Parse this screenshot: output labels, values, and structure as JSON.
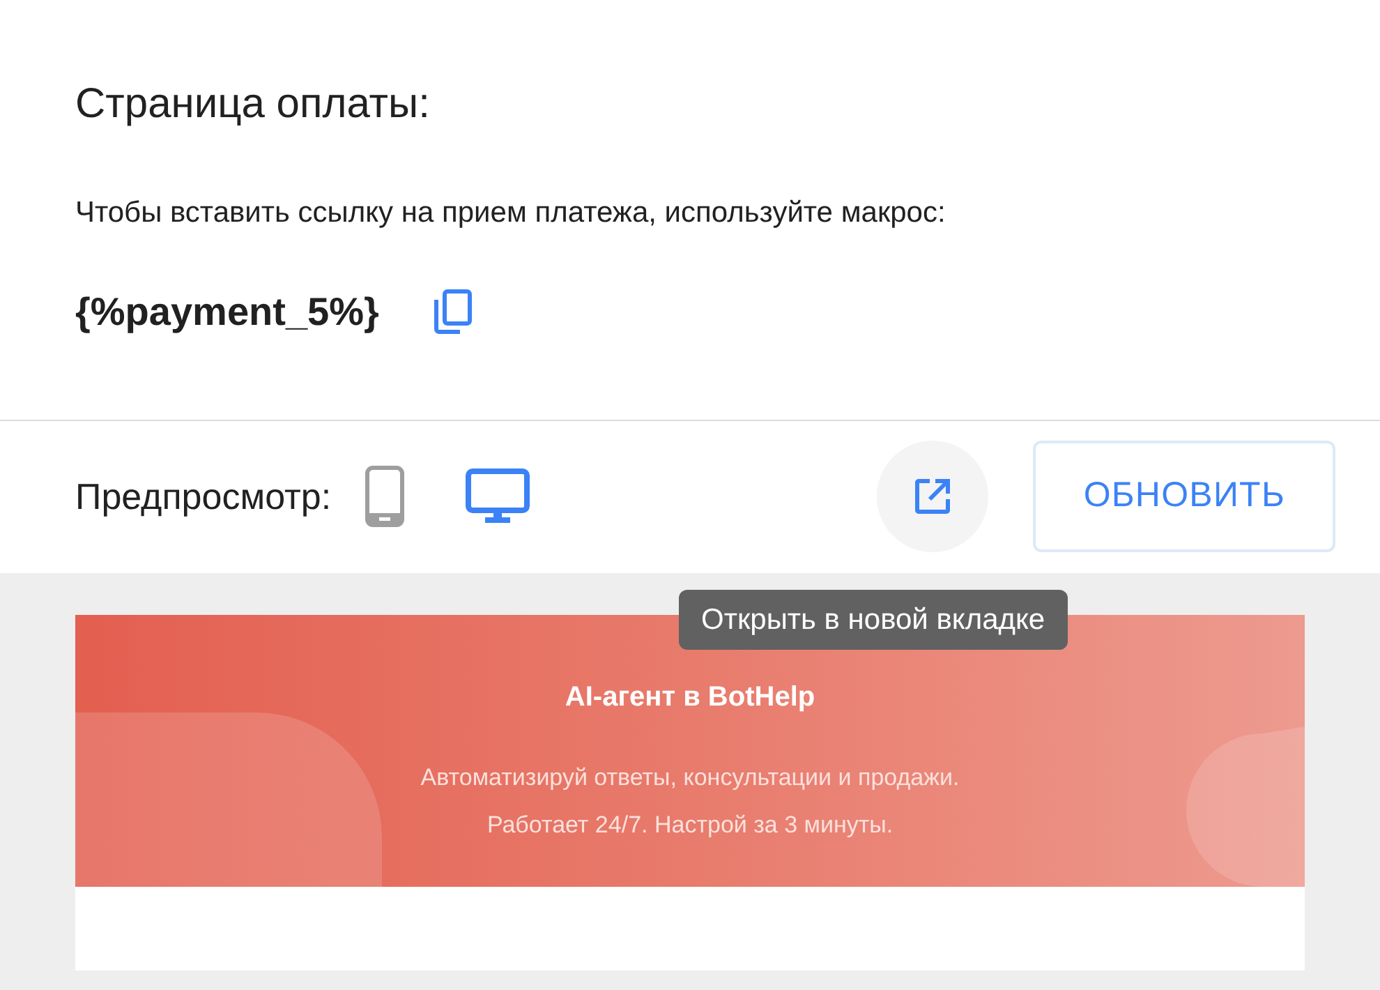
{
  "heading": "Страница оплаты:",
  "instruction": "Чтобы вставить ссылку на прием платежа, используйте макрос:",
  "macro": "{%payment_5%}",
  "preview": {
    "label": "Предпросмотр:",
    "devices": [
      {
        "kind": "mobile",
        "selected": false
      },
      {
        "kind": "desktop",
        "selected": true
      }
    ],
    "tooltip": "Открыть в новой вкладке",
    "refresh_button": "ОБНОВИТЬ"
  },
  "banner": {
    "title": "AI-агент в BotHelp",
    "lines": [
      "Автоматизируй ответы, консультации и продажи.",
      "Работает 24/7. Настрой за 3 минуты."
    ]
  }
}
